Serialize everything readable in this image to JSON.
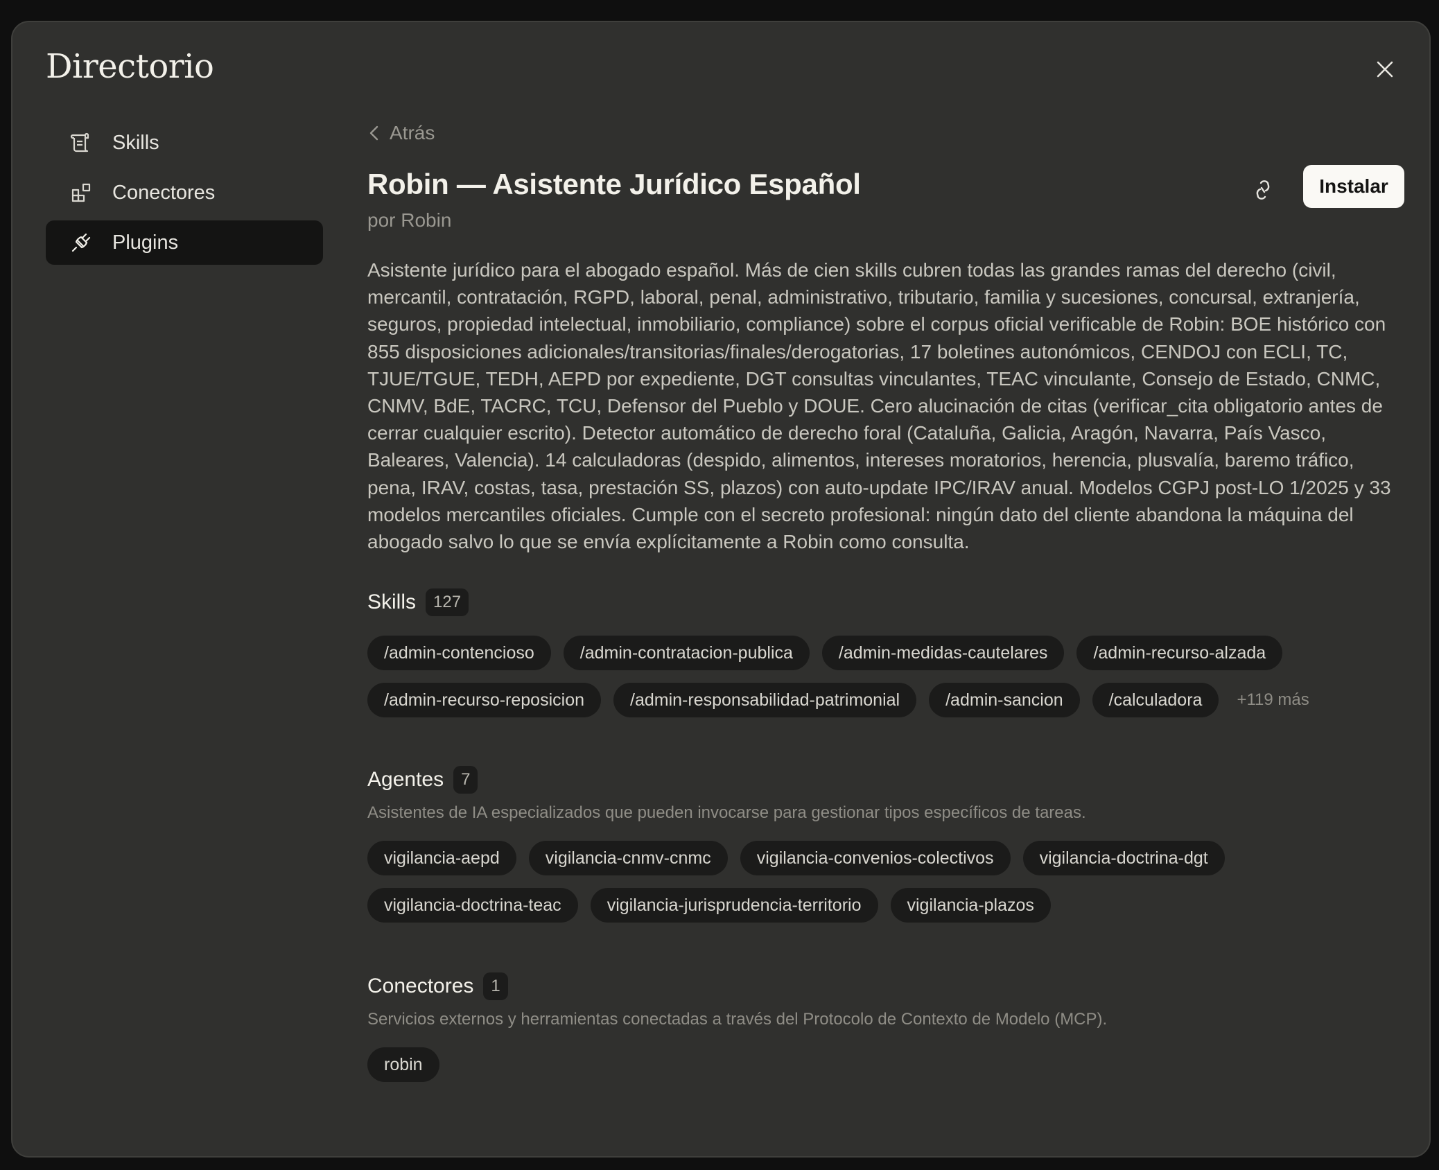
{
  "modal": {
    "title": "Directorio"
  },
  "sidebar": {
    "items": [
      {
        "label": "Skills",
        "icon": "scroll-icon",
        "active": false
      },
      {
        "label": "Conectores",
        "icon": "blocks-icon",
        "active": false
      },
      {
        "label": "Plugins",
        "icon": "plug-icon",
        "active": true
      }
    ]
  },
  "main": {
    "back_label": "Atrás",
    "title": "Robin — Asistente Jurídico Español",
    "author": "por Robin",
    "install_label": "Instalar",
    "description": "Asistente jurídico para el abogado español. Más de cien skills cubren todas las grandes ramas del derecho (civil, mercantil, contratación, RGPD, laboral, penal, administrativo, tributario, familia y sucesiones, concursal, extranjería, seguros, propiedad intelectual, inmobiliario, compliance) sobre el corpus oficial verificable de Robin: BOE histórico con 855 disposiciones adicionales/transitorias/finales/derogatorias, 17 boletines autonómicos, CENDOJ con ECLI, TC, TJUE/TGUE, TEDH, AEPD por expediente, DGT consultas vinculantes, TEAC vinculante, Consejo de Estado, CNMC, CNMV, BdE, TACRC, TCU, Defensor del Pueblo y DOUE. Cero alucinación de citas (verificar_cita obligatorio antes de cerrar cualquier escrito). Detector automático de derecho foral (Cataluña, Galicia, Aragón, Navarra, País Vasco, Baleares, Valencia). 14 calculadoras (despido, alimentos, intereses moratorios, herencia, plusvalía, baremo tráfico, pena, IRAV, costas, tasa, prestación SS, plazos) con auto-update IPC/IRAV anual. Modelos CGPJ post-LO 1/2025 y 33 modelos mercantiles oficiales. Cumple con el secreto profesional: ningún dato del cliente abandona la máquina del abogado salvo lo que se envía explícitamente a Robin como consulta."
  },
  "skills": {
    "title": "Skills",
    "count": "127",
    "items": [
      "/admin-contencioso",
      "/admin-contratacion-publica",
      "/admin-medidas-cautelares",
      "/admin-recurso-alzada",
      "/admin-recurso-reposicion",
      "/admin-responsabilidad-patrimonial",
      "/admin-sancion",
      "/calculadora"
    ],
    "more": "+119 más"
  },
  "agents": {
    "title": "Agentes",
    "count": "7",
    "description": "Asistentes de IA especializados que pueden invocarse para gestionar tipos específicos de tareas.",
    "items": [
      "vigilancia-aepd",
      "vigilancia-cnmv-cnmc",
      "vigilancia-convenios-colectivos",
      "vigilancia-doctrina-dgt",
      "vigilancia-doctrina-teac",
      "vigilancia-jurisprudencia-territorio",
      "vigilancia-plazos"
    ]
  },
  "connectors": {
    "title": "Conectores",
    "count": "1",
    "description": "Servicios externos y herramientas conectadas a través del Protocolo de Contexto de Modelo (MCP).",
    "items": [
      "robin"
    ]
  },
  "icons": [
    "close-icon",
    "chevron-left-icon",
    "link-icon"
  ]
}
